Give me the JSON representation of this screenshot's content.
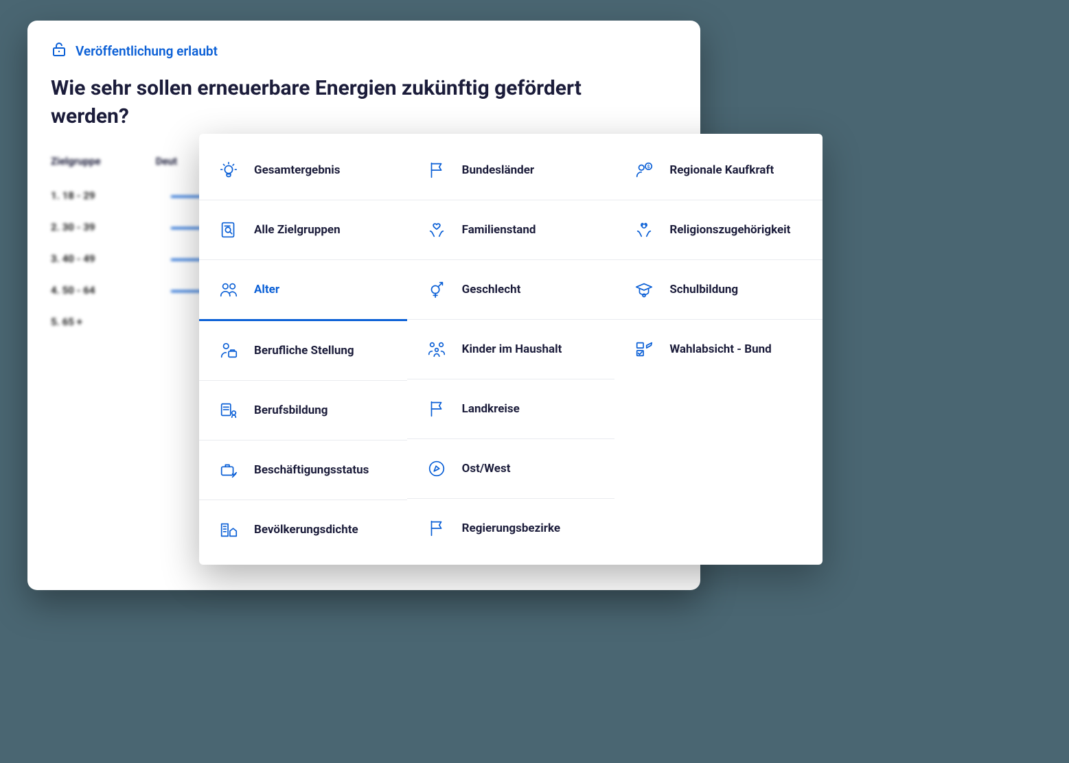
{
  "publication_status": "Veröffentlichung erlaubt",
  "question_title": "Wie sehr sollen erneuerbare Energien zukünftig gefördert werden?",
  "table": {
    "col1": "Zielgruppe",
    "col2": "Deut",
    "rows": [
      {
        "label": "1. 18 - 29",
        "bar": 70
      },
      {
        "label": "2. 30 - 39",
        "bar": 85
      },
      {
        "label": "3. 40 - 49",
        "bar": 90
      },
      {
        "label": "4. 50 - 64",
        "bar": 60
      },
      {
        "label": "5. 65 +",
        "bar": 0
      }
    ]
  },
  "filters": {
    "selected": "Alter",
    "col1": [
      "Gesamtergebnis",
      "Alle Zielgruppen",
      "Alter",
      "Berufliche Stellung",
      "Berufsbildung",
      "Beschäftigungsstatus",
      "Bevölkerungsdichte"
    ],
    "col2": [
      "Bundesländer",
      "Familienstand",
      "Geschlecht",
      "Kinder im Haushalt",
      "Landkreise",
      "Ost/West",
      "Regierungsbezirke"
    ],
    "col3": [
      "Regionale Kaufkraft",
      "Religionszugehörigkeit",
      "Schulbildung",
      "Wahlabsicht - Bund"
    ]
  }
}
